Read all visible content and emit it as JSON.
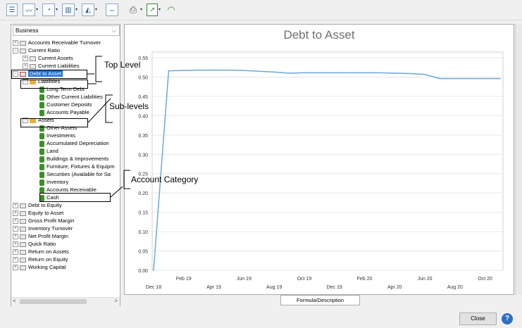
{
  "toolbar": {
    "buttons": [
      {
        "name": "report-list-icon",
        "glyph": "☰"
      },
      {
        "name": "line-chart-icon",
        "glyph": "〰"
      },
      {
        "name": "pie-chart-icon",
        "glyph": "◔"
      },
      {
        "name": "bar-chart-icon",
        "glyph": "▥"
      },
      {
        "name": "area-chart-icon",
        "glyph": "◭"
      },
      {
        "name": "split-view-icon",
        "glyph": "⇔"
      },
      {
        "name": "print-icon",
        "glyph": "⎙"
      },
      {
        "name": "export-icon",
        "glyph": "↗"
      },
      {
        "name": "gauge-icon",
        "glyph": "◠"
      }
    ]
  },
  "dropdown": {
    "value": "Business",
    "chevron": "⌵"
  },
  "tree": [
    {
      "label": "Accounts Receivable Turnover",
      "level": 0,
      "pm": "⊞",
      "icon": "report"
    },
    {
      "label": "Current Ratio",
      "level": 0,
      "pm": "⊟",
      "icon": "report"
    },
    {
      "label": "Current Assets",
      "level": 1,
      "pm": "⊞",
      "icon": "gear"
    },
    {
      "label": "Current Liabilities",
      "level": 1,
      "pm": "⊞",
      "icon": "gear"
    },
    {
      "label": "Debt to Asset",
      "level": 0,
      "pm": "⊟",
      "icon": "report-red",
      "selected": true
    },
    {
      "label": "Liabilities",
      "level": 1,
      "pm": "⊟",
      "icon": "folder"
    },
    {
      "label": "Long Term Debt",
      "level": 2,
      "icon": "coin"
    },
    {
      "label": "Other Current Liabilities",
      "level": 2,
      "icon": "coin"
    },
    {
      "label": "Customer Deposits",
      "level": 2,
      "icon": "coin"
    },
    {
      "label": "Accounts Payable",
      "level": 2,
      "icon": "coin"
    },
    {
      "label": "Assets",
      "level": 1,
      "pm": "⊟",
      "icon": "folder"
    },
    {
      "label": "Other Assets",
      "level": 2,
      "icon": "coin"
    },
    {
      "label": "Investments",
      "level": 2,
      "icon": "coin"
    },
    {
      "label": "Accumulated Depreciation",
      "level": 2,
      "icon": "coin"
    },
    {
      "label": "Land",
      "level": 2,
      "icon": "coin"
    },
    {
      "label": "Buildings & Improvements",
      "level": 2,
      "icon": "coin"
    },
    {
      "label": "Furniture, Fixtures & Equipm",
      "level": 2,
      "icon": "coin"
    },
    {
      "label": "Securities (Available for Sa",
      "level": 2,
      "icon": "coin"
    },
    {
      "label": "Inventory",
      "level": 2,
      "icon": "coin"
    },
    {
      "label": "Accounts Receivable",
      "level": 2,
      "icon": "coin"
    },
    {
      "label": "Cash",
      "level": 2,
      "icon": "coin"
    },
    {
      "label": "Debt to Equity",
      "level": 0,
      "pm": "⊞",
      "icon": "report"
    },
    {
      "label": "Equity to Asset",
      "level": 0,
      "pm": "⊞",
      "icon": "report"
    },
    {
      "label": "Gross Profit Margin",
      "level": 0,
      "pm": "⊞",
      "icon": "report"
    },
    {
      "label": "Inventory Turnover",
      "level": 0,
      "pm": "⊞",
      "icon": "report"
    },
    {
      "label": "Net Profit Margin",
      "level": 0,
      "pm": "⊞",
      "icon": "report"
    },
    {
      "label": "Quick Ratio",
      "level": 0,
      "pm": "⊞",
      "icon": "report"
    },
    {
      "label": "Return on Assets",
      "level": 0,
      "pm": "⊞",
      "icon": "report"
    },
    {
      "label": "Return on Equity",
      "level": 0,
      "pm": "⊞",
      "icon": "report"
    },
    {
      "label": "Working Capital",
      "level": 0,
      "pm": "⊞",
      "icon": "report"
    }
  ],
  "scroll": {
    "left": "<",
    "right": ">"
  },
  "annotations": {
    "top_level": "Top Level",
    "sub_levels": "Sub-levels",
    "account_category": "Account Category"
  },
  "bottom": {
    "tab_label": "Formula/Description",
    "close_label": "Close",
    "help_glyph": "?"
  },
  "chart_data": {
    "type": "line",
    "title": "Debt to Asset",
    "ylim": [
      0,
      0.55
    ],
    "yticks": [
      "0.00",
      "0.05",
      "0.10",
      "0.15",
      "0.20",
      "0.25",
      "0.30",
      "0.35",
      "0.40",
      "0.45",
      "0.50",
      "0.55"
    ],
    "xticks_top": [
      "Feb 19",
      "Jun 19",
      "Oct 19",
      "Feb 20",
      "Jun 20",
      "Oct 20"
    ],
    "xticks_bottom": [
      "Dec 18",
      "Apr 19",
      "Aug 19",
      "Dec 19",
      "Apr 20",
      "Aug 20"
    ],
    "x": [
      "Dec 18",
      "Jan 19",
      "Feb 19",
      "Mar 19",
      "Apr 19",
      "May 19",
      "Jun 19",
      "Jul 19",
      "Aug 19",
      "Sep 19",
      "Oct 19",
      "Nov 19",
      "Dec 19",
      "Jan 20",
      "Feb 20",
      "Mar 20",
      "Apr 20",
      "May 20",
      "Jun 20",
      "Jul 20",
      "Aug 20",
      "Sep 20",
      "Oct 20",
      "Nov 20"
    ],
    "series": [
      {
        "values": [
          0.0,
          0.516,
          0.517,
          0.518,
          0.518,
          0.518,
          0.517,
          0.515,
          0.513,
          0.51,
          0.511,
          0.511,
          0.511,
          0.511,
          0.511,
          0.511,
          0.51,
          0.509,
          0.507,
          0.496,
          0.496,
          0.496,
          0.496,
          0.496
        ],
        "color": "#6aaad8"
      }
    ]
  }
}
